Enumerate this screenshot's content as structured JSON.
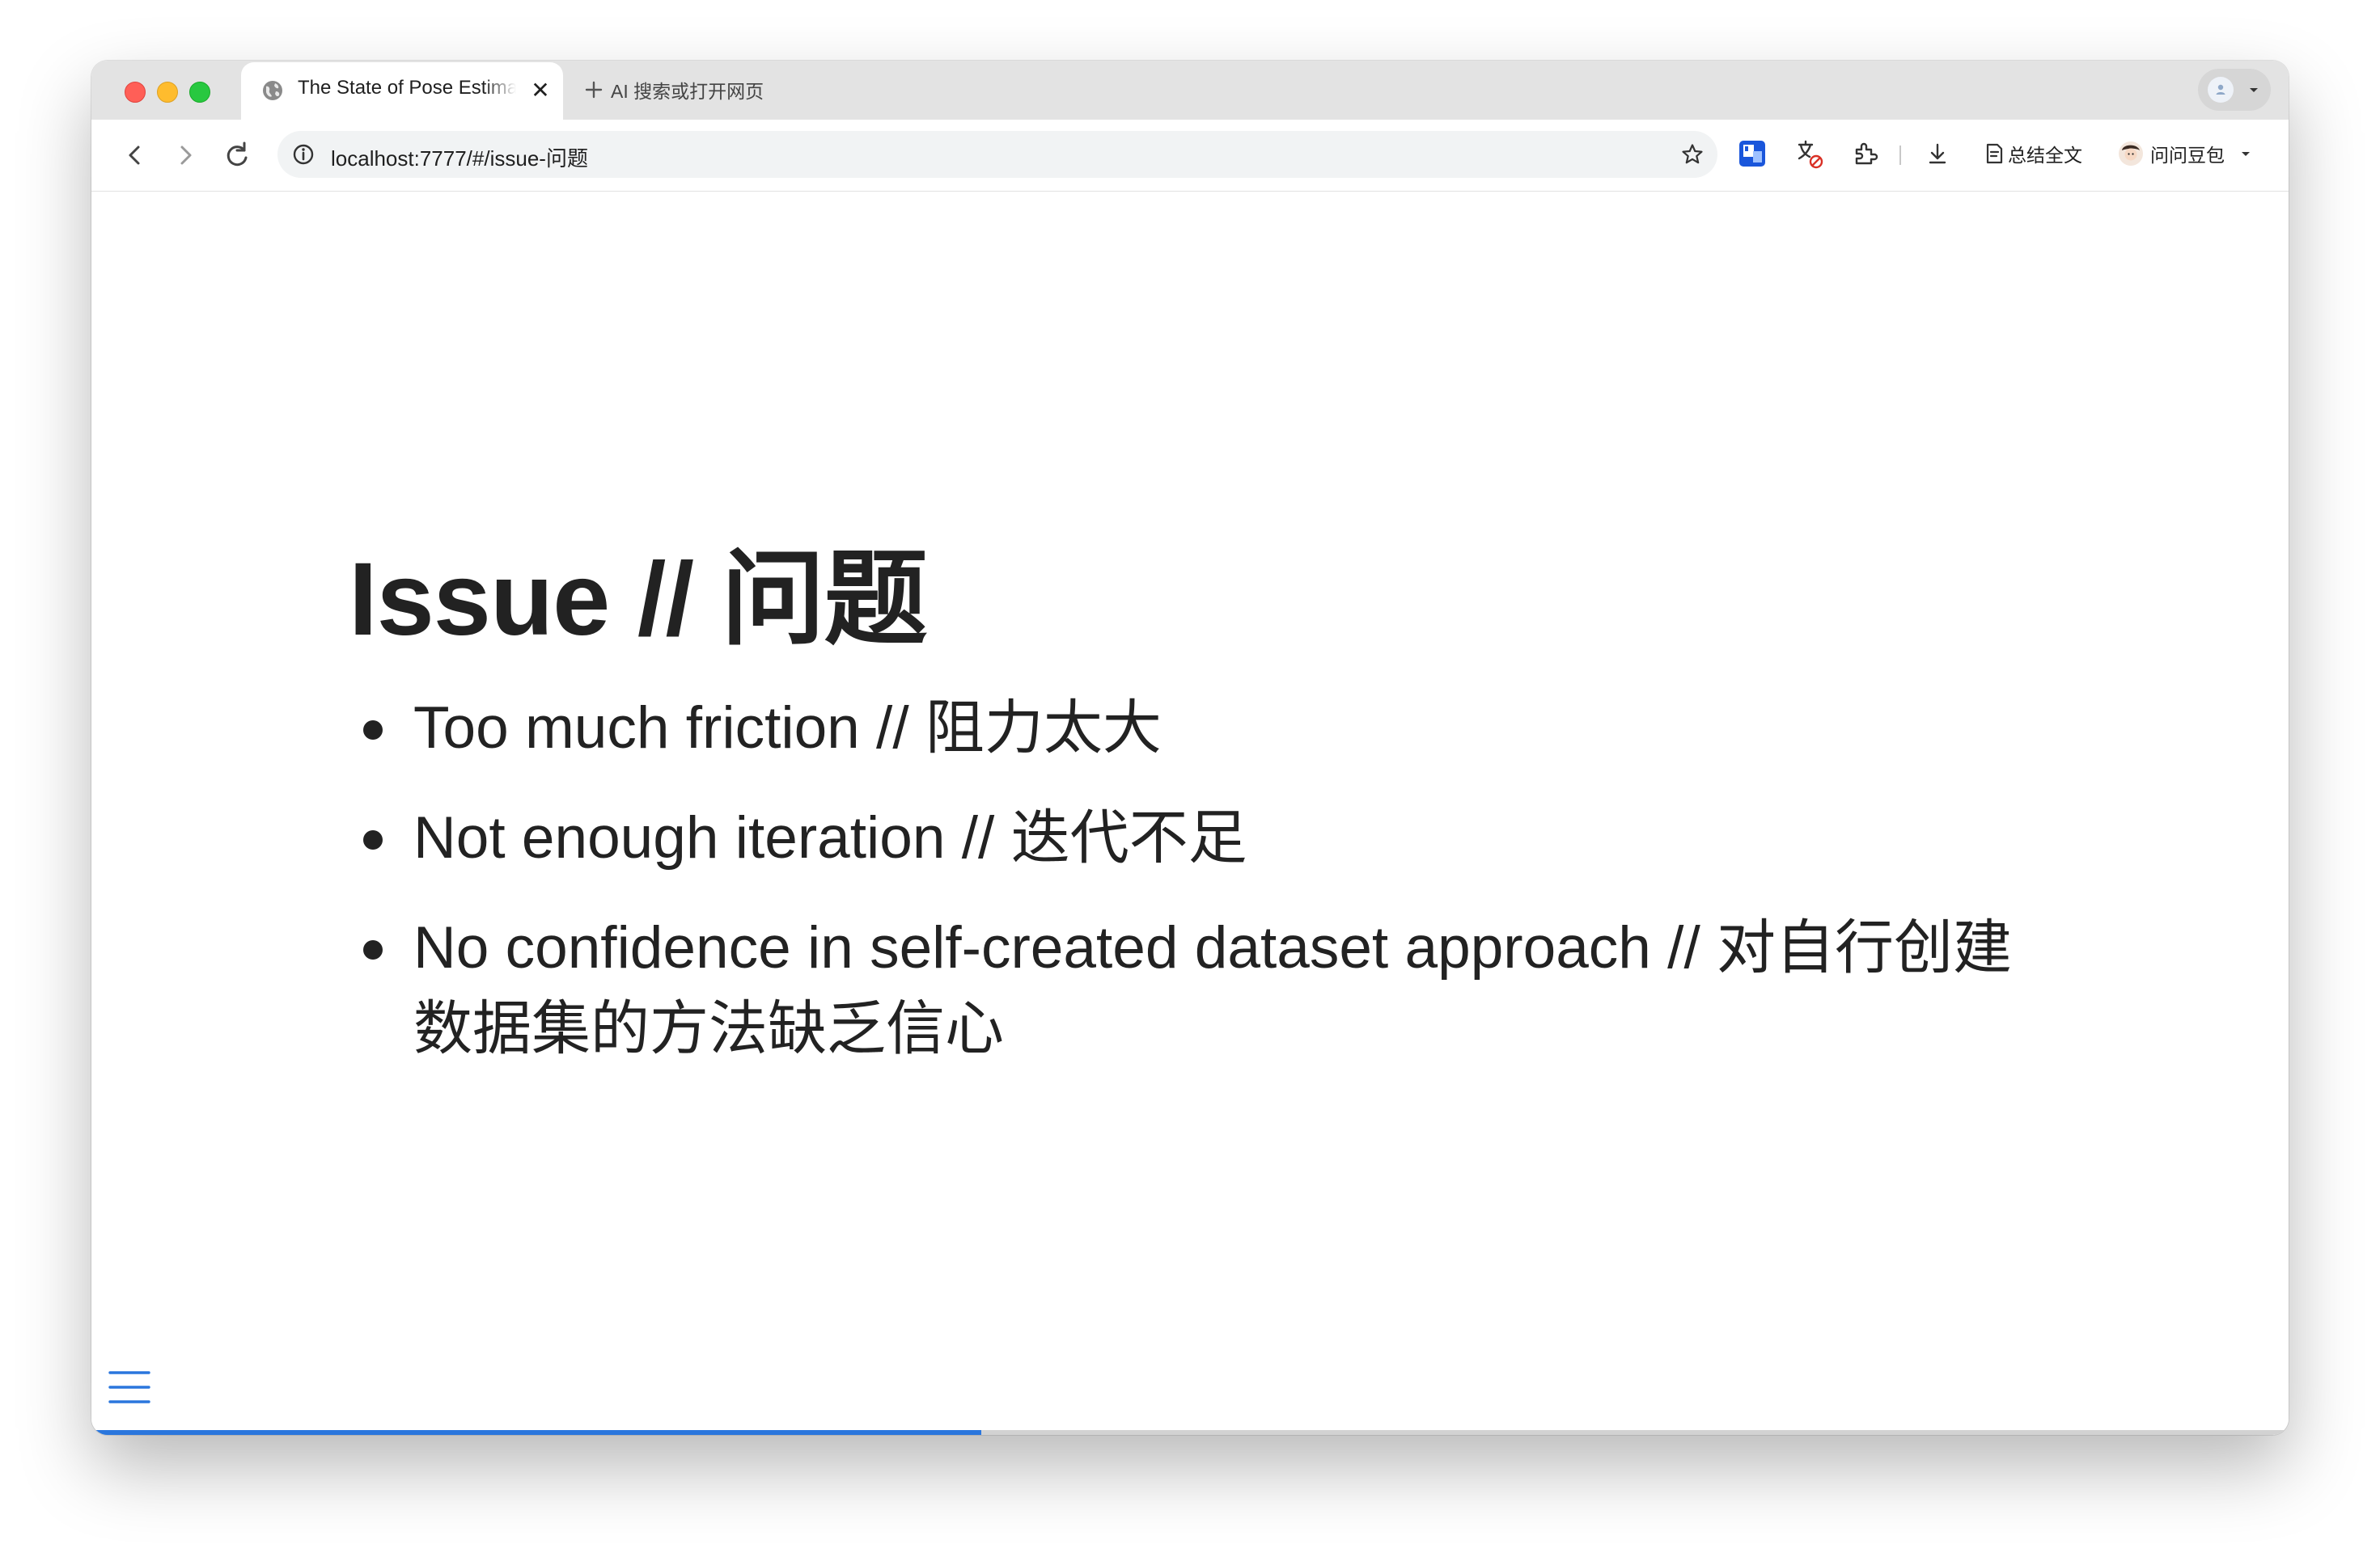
{
  "browser": {
    "tab": {
      "title": "The State of Pose Estimation"
    },
    "new_tab": {
      "label": "AI 搜索或打开网页"
    },
    "address_bar": {
      "url": "localhost:7777/#/issue-问题"
    },
    "toolbar": {
      "summarize_label": "总结全文",
      "assistant_label": "问问豆包"
    }
  },
  "slide": {
    "title": "Issue // 问题",
    "bullets": [
      "Too much friction // 阻力太大",
      "Not enough iteration // 迭代不足",
      "No confidence in self-created dataset approach // 对自行创建数据集的方法缺乏信心"
    ],
    "progress": 0.405
  },
  "colors": {
    "accent": "#2a76dd",
    "text": "#222222",
    "traffic_red": "#ff5f57",
    "traffic_yellow": "#febc2e",
    "traffic_green": "#28c840"
  }
}
